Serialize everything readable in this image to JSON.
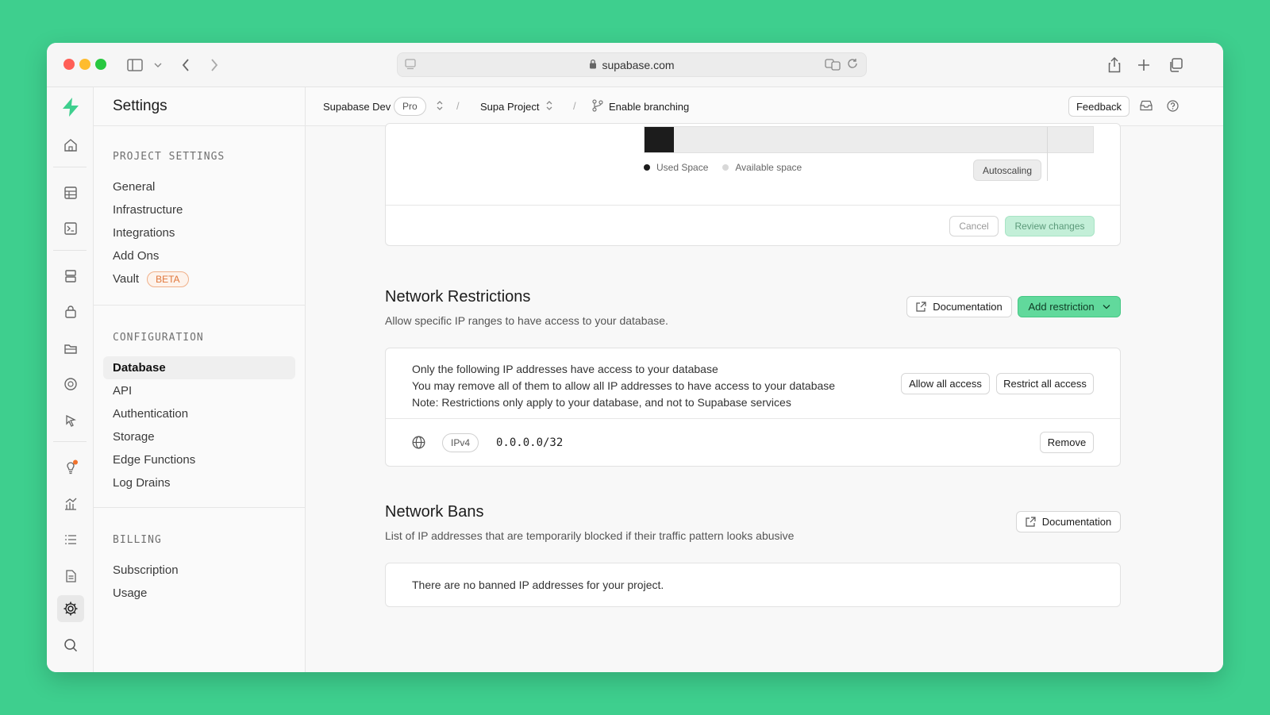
{
  "browser": {
    "url": "supabase.com",
    "colors": {
      "close": "#ff5f57",
      "minimize": "#febc2e",
      "zoom": "#28c840"
    }
  },
  "sidebar": {
    "title": "Settings",
    "project_settings": {
      "heading": "PROJECT SETTINGS",
      "items": [
        "General",
        "Infrastructure",
        "Integrations",
        "Add Ons",
        "Vault"
      ],
      "vault_badge": "BETA"
    },
    "configuration": {
      "heading": "CONFIGURATION",
      "items": [
        "Database",
        "API",
        "Authentication",
        "Storage",
        "Edge Functions",
        "Log Drains"
      ],
      "active": "Database"
    },
    "billing": {
      "heading": "BILLING",
      "items": [
        "Subscription",
        "Usage"
      ]
    }
  },
  "topbar": {
    "org": "Supabase Dev",
    "plan": "Pro",
    "project": "Supa Project",
    "branching": "Enable branching",
    "feedback": "Feedback"
  },
  "disk": {
    "used_fraction": 0.065,
    "legend_used": "Used Space",
    "legend_available": "Available space",
    "autoscaling": "Autoscaling",
    "cancel": "Cancel",
    "review": "Review changes"
  },
  "network_restrictions": {
    "title": "Network Restrictions",
    "subtitle": "Allow specific IP ranges to have access to your database.",
    "documentation": "Documentation",
    "add_restriction": "Add restriction",
    "info_line1": "Only the following IP addresses have access to your database",
    "info_line2": "You may remove all of them to allow all IP addresses to have access to your database",
    "info_line3": "Note: Restrictions only apply to your database, and not to Supabase services",
    "allow_all": "Allow all access",
    "restrict_all": "Restrict all access",
    "entries": [
      {
        "type": "IPv4",
        "cidr": "0.0.0.0/32",
        "action": "Remove"
      }
    ]
  },
  "network_bans": {
    "title": "Network Bans",
    "subtitle": "List of IP addresses that are temporarily blocked if their traffic pattern looks abusive",
    "documentation": "Documentation",
    "empty": "There are no banned IP addresses for your project."
  }
}
